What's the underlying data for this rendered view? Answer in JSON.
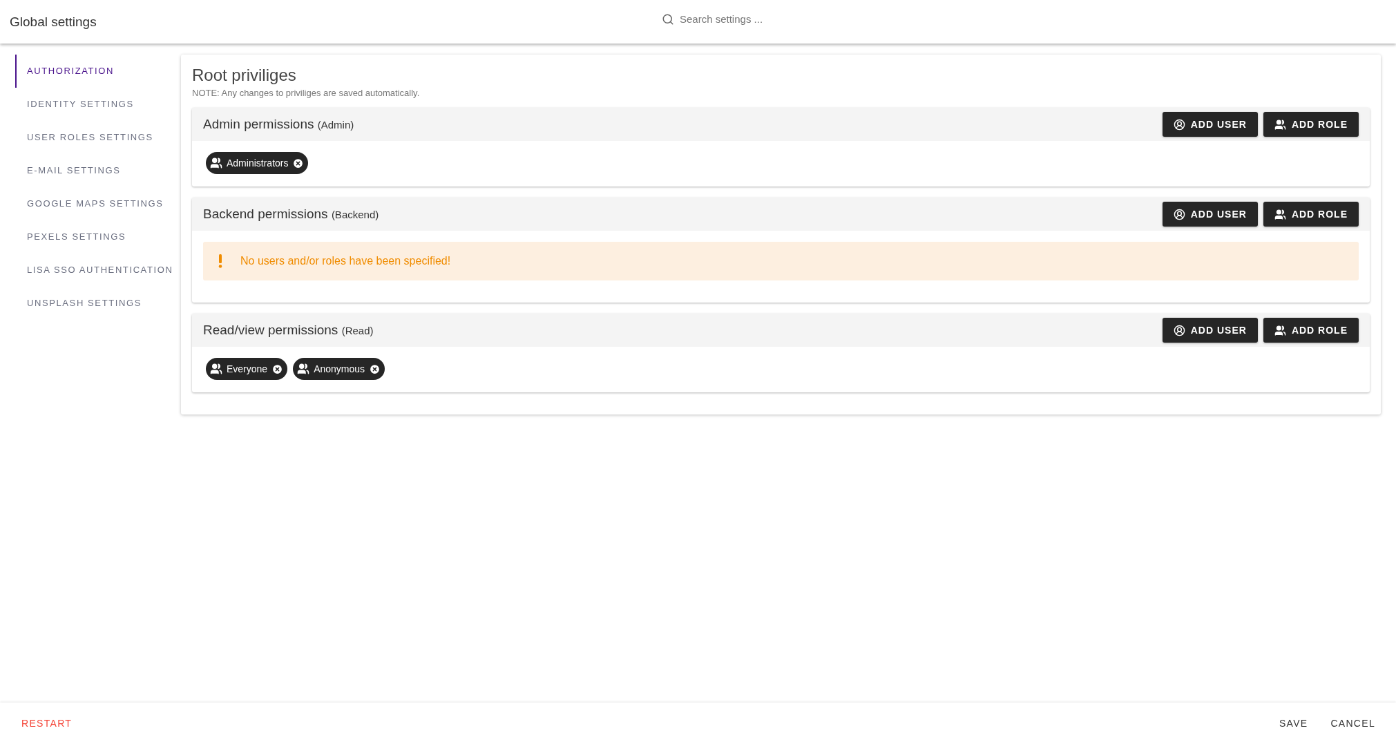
{
  "header": {
    "title": "Global settings",
    "search": {
      "placeholder": "Search settings ..."
    }
  },
  "sidebar": {
    "items": [
      {
        "label": "AUTHORIZATION",
        "selected": true
      },
      {
        "label": "IDENTITY SETTINGS",
        "selected": false
      },
      {
        "label": "USER ROLES SETTINGS",
        "selected": false
      },
      {
        "label": "E-MAIL SETTINGS",
        "selected": false
      },
      {
        "label": "GOOGLE MAPS SETTINGS",
        "selected": false
      },
      {
        "label": "PEXELS SETTINGS",
        "selected": false
      },
      {
        "label": "LISA SSO AUTHENTICATION",
        "selected": false
      },
      {
        "label": "UNSPLASH SETTINGS",
        "selected": false
      }
    ]
  },
  "main": {
    "title": "Root priviliges",
    "note": "NOTE: Any changes to priviliges are saved automatically.",
    "sections": [
      {
        "title": "Admin permissions",
        "subtitle": "(Admin)",
        "buttons": [
          "ADD USER",
          "ADD ROLE"
        ],
        "kind": "chips",
        "chips": [
          "Administrators"
        ]
      },
      {
        "title": "Backend permissions",
        "subtitle": "(Backend)",
        "buttons": [
          "ADD USER",
          "ADD ROLE"
        ],
        "kind": "warning",
        "warning": "No users and/or roles have been specified!"
      },
      {
        "title": "Read/view permissions",
        "subtitle": "(Read)",
        "buttons": [
          "ADD USER",
          "ADD ROLE"
        ],
        "kind": "chips",
        "chips": [
          "Everyone",
          "Anonymous"
        ]
      }
    ]
  },
  "footer": {
    "restart": "RESTART",
    "save": "SAVE",
    "cancel": "CANCEL"
  }
}
